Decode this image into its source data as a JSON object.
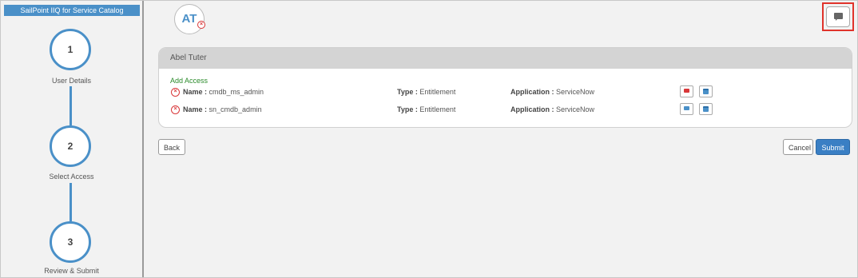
{
  "sidebar": {
    "title": "SailPoint IIQ for Service Catalog",
    "steps": [
      {
        "number": "1",
        "label": "User Details"
      },
      {
        "number": "2",
        "label": "Select Access"
      },
      {
        "number": "3",
        "label": "Review & Submit"
      }
    ]
  },
  "user": {
    "initials": "AT",
    "name": "Abel Tuter"
  },
  "access": {
    "section_label": "Add Access",
    "name_label": "Name :",
    "type_label": "Type :",
    "app_label": "Application :",
    "items": [
      {
        "name": "cmdb_ms_admin",
        "type": "Entitlement",
        "application": "ServiceNow",
        "comment_color": "#d9383a"
      },
      {
        "name": "sn_cmdb_admin",
        "type": "Entitlement",
        "application": "ServiceNow",
        "comment_color": "#4a90c8"
      }
    ]
  },
  "actions": {
    "back": "Back",
    "cancel": "Cancel",
    "submit": "Submit"
  },
  "colors": {
    "accent": "#4a90c8",
    "danger": "#d9383a",
    "add_access": "#2a8a2a"
  },
  "icons": {
    "chat": "chat-icon",
    "remove": "remove-icon",
    "comment": "comment-icon",
    "calendar": "calendar-icon"
  }
}
